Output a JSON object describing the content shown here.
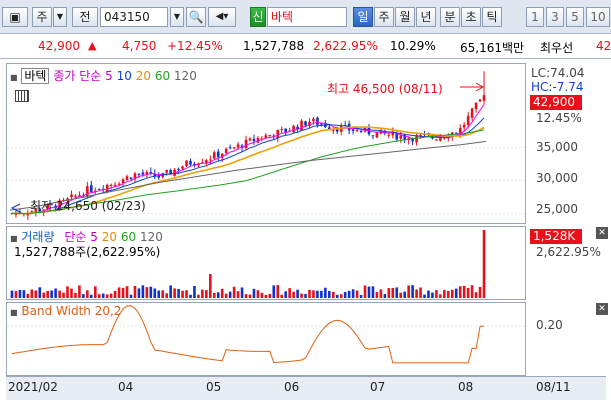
{
  "toolbar": {
    "type_select": "주",
    "type_select2": "전",
    "code_value": "043150",
    "badge": "신",
    "stock_name": "바텍",
    "periods": [
      "일",
      "주",
      "월",
      "년",
      "분",
      "초",
      "틱"
    ],
    "minutes": [
      "1",
      "3",
      "5",
      "10"
    ]
  },
  "price_bar": {
    "price": "42,900",
    "change": "4,750",
    "change_pct": "+12.45%",
    "volume": "1,527,788",
    "volume_ratio": "2,622.95%",
    "turnover": "10.29%",
    "amount": "65,161백만",
    "preferred": "최우선",
    "preferred_value": "42"
  },
  "main_panel": {
    "title": "바텍",
    "ma_label": "종가 단순",
    "ma_periods": [
      "5",
      "10",
      "20",
      "60",
      "120"
    ],
    "ma_colors": [
      "#ff00ff",
      "#1040d0",
      "#f0a000",
      "#20a020",
      "#666666"
    ],
    "high_label": "최고 46,500 (08/11)",
    "low_label": "최저 24,650 (02/23)",
    "lc": "LC:74.04",
    "hc": "HC:-7.74",
    "current_tag": "42,900",
    "pct_tag": "12.45%",
    "y_ticks": [
      "35,000",
      "30,000",
      "25,000"
    ]
  },
  "volume_panel": {
    "title": "거래량",
    "ma_label": "단순",
    "ma_periods": [
      "5",
      "20",
      "60",
      "120"
    ],
    "value_text": "1,527,788주(2,622.95%)",
    "tag": "1,528K",
    "tag2": "2,622.95%"
  },
  "bw_panel": {
    "title": "Band Width 20,2",
    "y_tick": "0.20"
  },
  "x_axis": {
    "labels": [
      "2021/02",
      "04",
      "05",
      "06",
      "07",
      "08",
      "08/11"
    ]
  },
  "chart_data": {
    "type": "line",
    "x": [
      "2021/02",
      "04",
      "05",
      "06",
      "07",
      "08",
      "08/11"
    ],
    "price_series": [
      {
        "name": "close",
        "values": [
          25000,
          25500,
          26500,
          28500,
          29500,
          31000,
          30500,
          32500,
          33500,
          35000,
          36500,
          37500,
          39000,
          38000,
          37500,
          37000,
          36500,
          36500,
          37500,
          42900
        ]
      },
      {
        "name": "MA 120",
        "values": [
          25500,
          26000,
          26800,
          27500,
          28300,
          29000,
          29700,
          30300,
          30900,
          31500,
          32000,
          32500,
          33000,
          33400,
          33800,
          34200,
          34600,
          35000,
          35400,
          35900
        ]
      }
    ],
    "high": 46500,
    "low": 24650,
    "current": 42900,
    "change_pct": 12.45,
    "volume_last": 1527788,
    "bandwidth_last": 0.2,
    "ylim": [
      24000,
      47000
    ]
  }
}
